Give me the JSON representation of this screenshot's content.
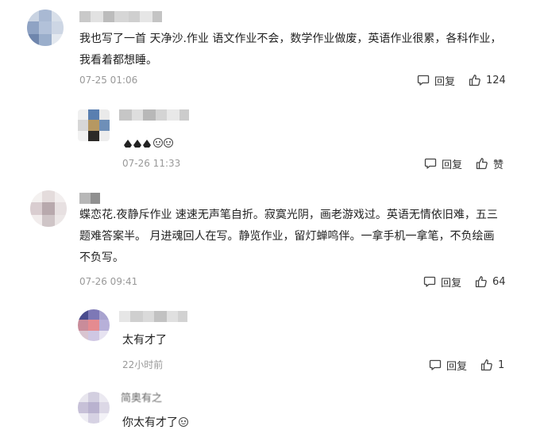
{
  "comments": [
    {
      "text_lines": [
        "我也写了一首 天净沙.作业 语文作业不会，数学作业做废，英语作业很累，各科作业，",
        "我看着都想睡。"
      ],
      "time": "07-25 01:06",
      "reply_label": "回复",
      "like_count": "124"
    },
    {
      "text": "",
      "time": "07-26 11:33",
      "reply_label": "回复",
      "like_label": "赞"
    },
    {
      "text_lines": [
        "蝶恋花.夜静斥作业 速速无声笔自折。寂寞光阴，画老游戏过。英语无情依旧难，五三",
        "题难答案半。 月进魂回人在写。静览作业，留灯蝉鸣伴。一拿手机一拿笔，不负绘画",
        "不负写。"
      ],
      "time": "07-26 09:41",
      "reply_label": "回复",
      "like_count": "64"
    },
    {
      "text": "太有才了",
      "time": "22小时前",
      "reply_label": "回复",
      "like_count": "1"
    },
    {
      "name_partial": "简奥有之",
      "text": "你太有才了"
    }
  ],
  "icons": {
    "reply": "comment-bubble-icon",
    "like": "thumbs-up-icon",
    "emoji": "smile-emoji-icon",
    "hand": "pointing-hand-emoji-icon"
  }
}
